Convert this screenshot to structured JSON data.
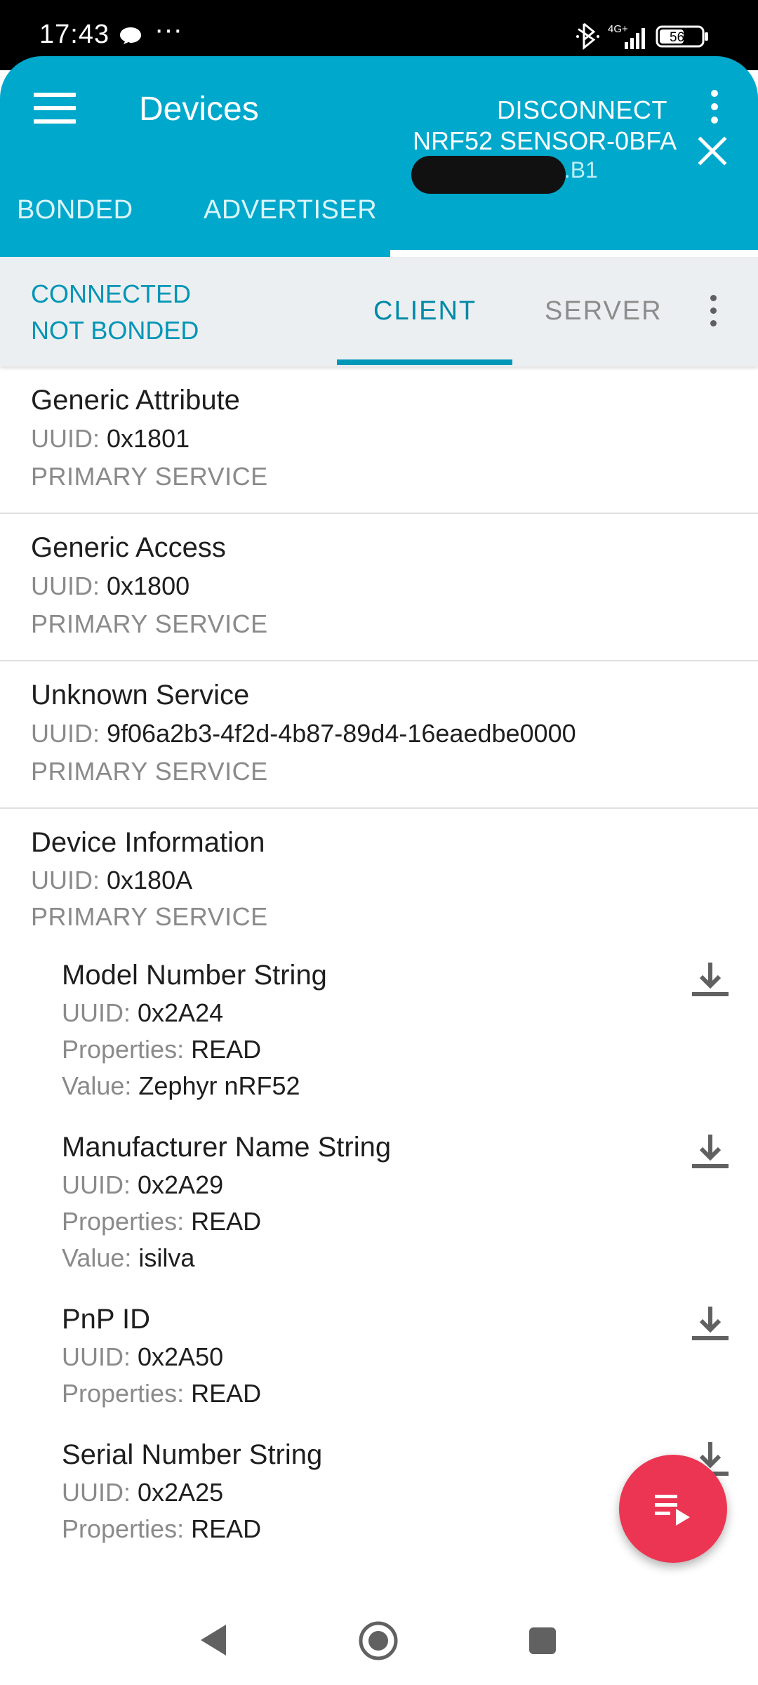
{
  "status_bar": {
    "time": "17:43",
    "more_notifications": "···",
    "icons": [
      "chat-bubble-icon",
      "bluetooth-icon",
      "signal-4g-icon",
      "battery-icon"
    ],
    "network_label": "4G+",
    "battery_level": "56"
  },
  "app_bar": {
    "title": "Devices",
    "disconnect_label": "DISCONNECT",
    "accent_color": "#00a8cc"
  },
  "device_tabs": {
    "bonded": "BONDED",
    "advertiser": "ADVERTISER",
    "device_name": "NRF52 SENSOR-0BFA",
    "device_address_visible": "3.B1"
  },
  "connection": {
    "status": "CONNECTED",
    "bond_state": "NOT BONDED",
    "tabs": {
      "client": "CLIENT",
      "server": "SERVER"
    },
    "selected_tab": "CLIENT"
  },
  "labels": {
    "uuid": "UUID:",
    "properties": "Properties:",
    "value": "Value:"
  },
  "services": [
    {
      "name": "Generic Attribute",
      "uuid": "0x1801",
      "type": "PRIMARY SERVICE"
    },
    {
      "name": "Generic Access",
      "uuid": "0x1800",
      "type": "PRIMARY SERVICE"
    },
    {
      "name": "Unknown Service",
      "uuid": "9f06a2b3-4f2d-4b87-89d4-16eaedbe0000",
      "type": "PRIMARY SERVICE"
    },
    {
      "name": "Device Information",
      "uuid": "0x180A",
      "type": "PRIMARY SERVICE",
      "characteristics": [
        {
          "name": "Model Number String",
          "uuid": "0x2A24",
          "properties": "READ",
          "value": "Zephyr nRF52"
        },
        {
          "name": "Manufacturer Name String",
          "uuid": "0x2A29",
          "properties": "READ",
          "value": "isilva"
        },
        {
          "name": "PnP ID",
          "uuid": "0x2A50",
          "properties": "READ"
        },
        {
          "name": "Serial Number String",
          "uuid": "0x2A25",
          "properties": "READ"
        }
      ]
    }
  ],
  "fab_color": "#ec3553"
}
